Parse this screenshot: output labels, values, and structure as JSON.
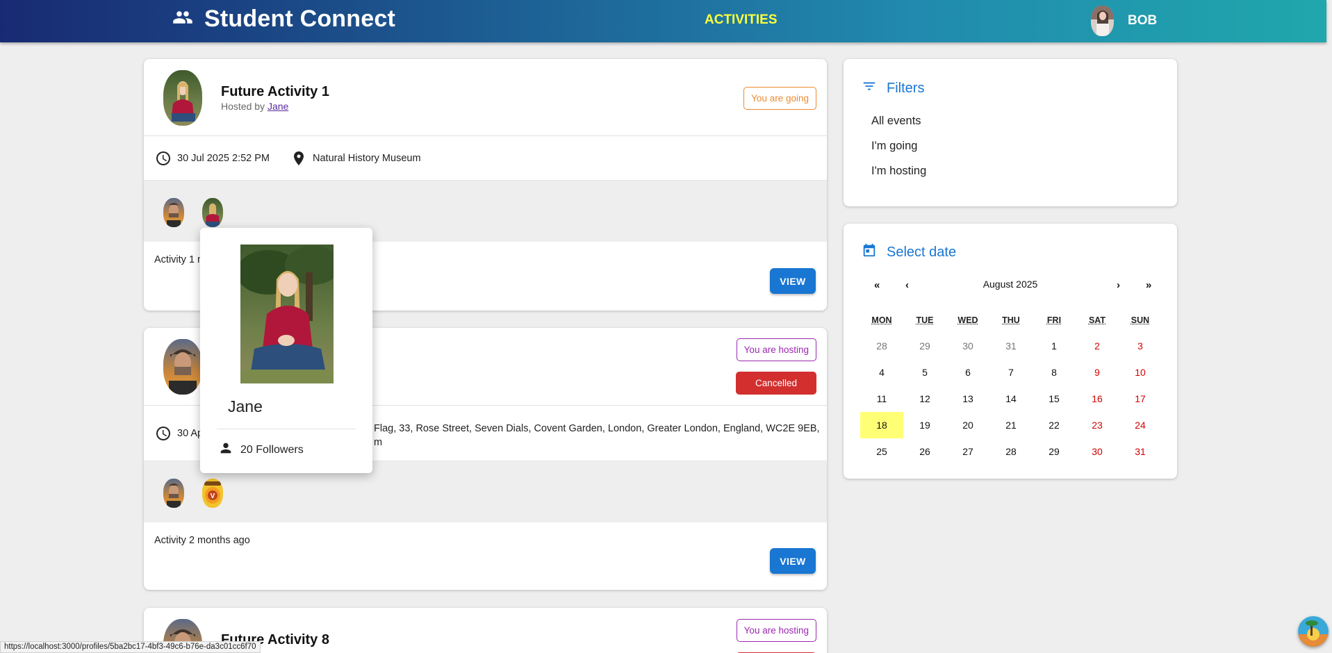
{
  "app": {
    "title": "Student Connect",
    "nav_activities": "ACTIVITIES",
    "user_name": "BOB"
  },
  "activities": [
    {
      "title": "Future Activity 1",
      "hosted_by_prefix": "Hosted by ",
      "host_name": "Jane",
      "status": "You are going",
      "date": "30 Jul 2025 2:52 PM",
      "venue": "Natural History Museum",
      "description": "Activity 1 month in future",
      "view_label": "VIEW"
    },
    {
      "title": "",
      "status": "You are hosting",
      "cancelled": "Cancelled",
      "date": "30 Ap",
      "venue": "Flag, 33, Rose Street, Seven Dials, Covent Garden, London, Greater London, England, WC2E 9EB,",
      "venue_line2": "m",
      "description": "Activity 2 months ago",
      "view_label": "VIEW"
    },
    {
      "title": "Future Activity 8",
      "status": "You are hosting"
    }
  ],
  "filters": {
    "title": "Filters",
    "items": [
      "All events",
      "I'm going",
      "I'm hosting"
    ]
  },
  "calendar": {
    "title": "Select date",
    "month": "August 2025",
    "nav_first": "«",
    "nav_prev": "‹",
    "nav_next": "›",
    "nav_last": "»",
    "weekdays": [
      "MON",
      "TUE",
      "WED",
      "THU",
      "FRI",
      "SAT",
      "SUN"
    ],
    "weeks": [
      [
        "28",
        "29",
        "30",
        "31",
        "1",
        "2",
        "3"
      ],
      [
        "4",
        "5",
        "6",
        "7",
        "8",
        "9",
        "10"
      ],
      [
        "11",
        "12",
        "13",
        "14",
        "15",
        "16",
        "17"
      ],
      [
        "18",
        "19",
        "20",
        "21",
        "22",
        "23",
        "24"
      ],
      [
        "25",
        "26",
        "27",
        "28",
        "29",
        "30",
        "31"
      ]
    ],
    "selected_day": "18"
  },
  "popover": {
    "name": "Jane",
    "followers": "20 Followers"
  },
  "status_url": "https://localhost:3000/profiles/5ba2bc17-4bf3-49c6-b76e-da3c01cc6f70",
  "colors": {
    "primary": "#1976d2",
    "going": "#ef8a2f",
    "hosting": "#9c27b0",
    "cancelled": "#d32f2f",
    "weekend": "#d10000",
    "today": "#ffff76",
    "nav_active": "#ffff3d"
  },
  "icons": {
    "brand": "group-icon",
    "time": "clock-icon",
    "place": "location-pin-icon",
    "filter": "filter-list-icon",
    "calendar": "calendar-icon",
    "followers": "person-icon"
  }
}
